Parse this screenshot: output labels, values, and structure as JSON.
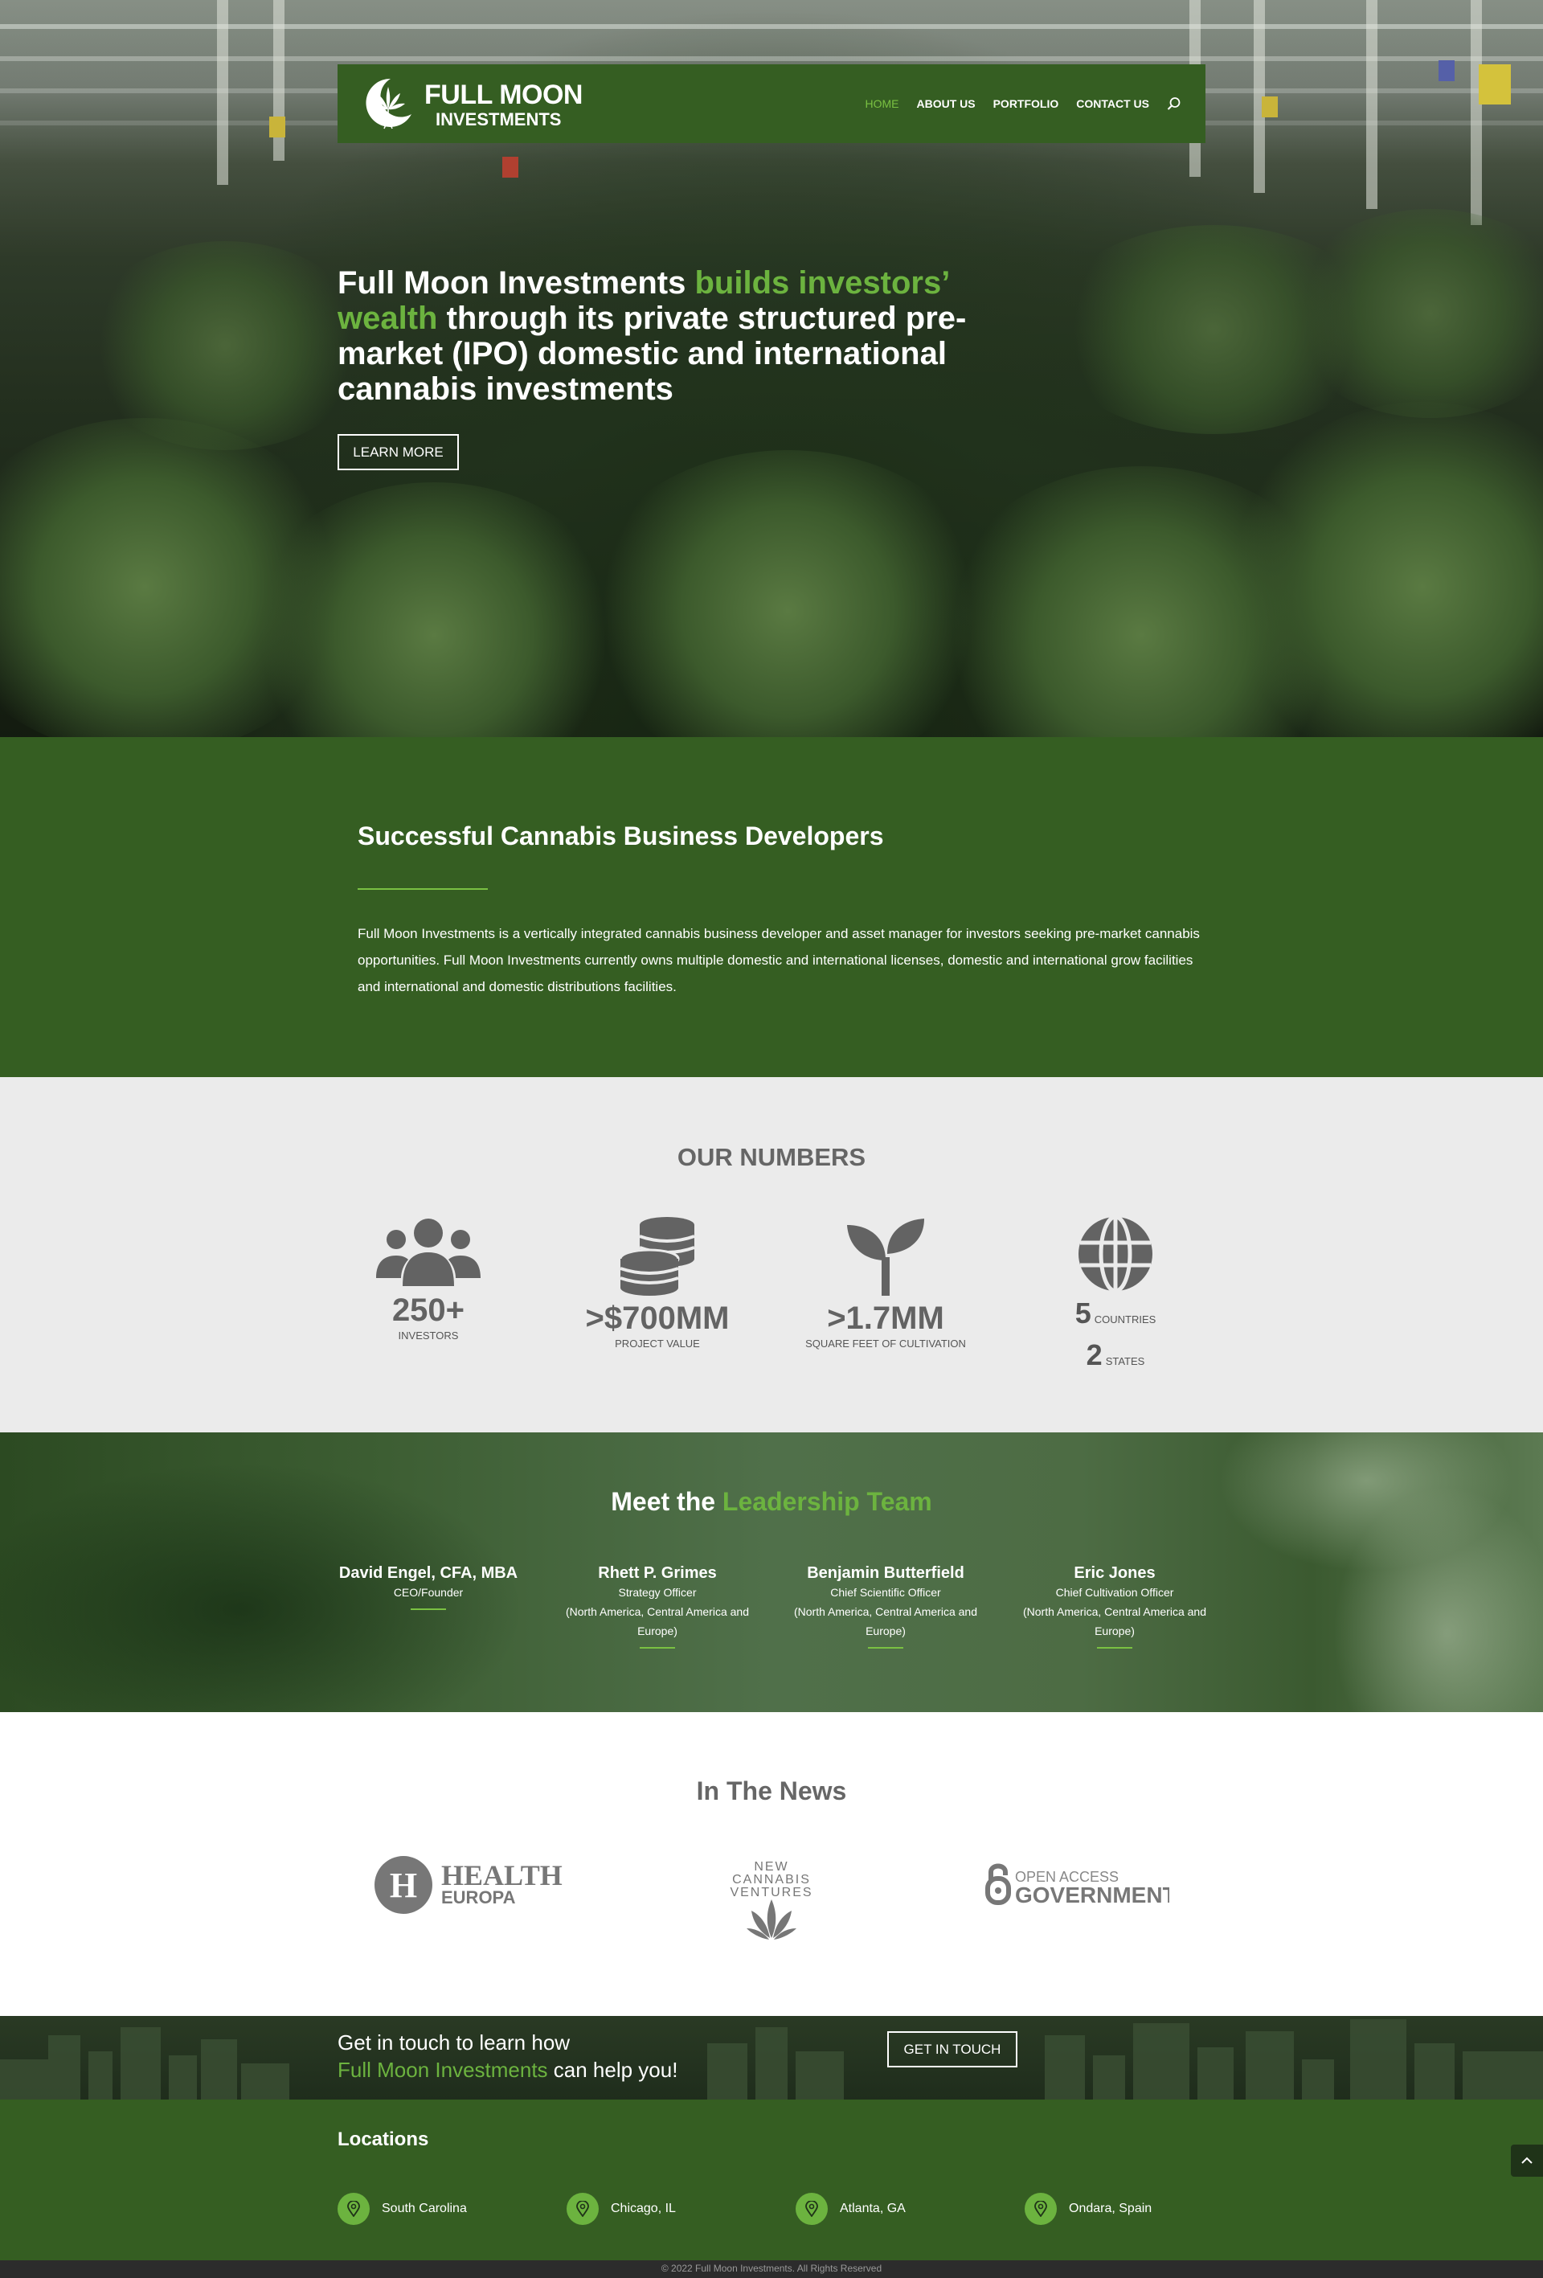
{
  "brand": {
    "name_line1": "FULL MOON",
    "name_line2": "INVESTMENTS"
  },
  "nav": {
    "items": [
      {
        "label": "HOME",
        "active": true
      },
      {
        "label": "ABOUT US",
        "active": false
      },
      {
        "label": "PORTFOLIO",
        "active": false
      },
      {
        "label": "CONTACT US",
        "active": false
      }
    ],
    "search_icon": "search-icon"
  },
  "hero": {
    "headline_part1": "Full Moon Investments ",
    "headline_highlight": "builds investors’ wealth",
    "headline_part2": " through its private structured pre-market (IPO) domestic and international cannabis investments",
    "button_label": "LEARN MORE"
  },
  "about": {
    "title": "Successful Cannabis Business Developers",
    "body": "Full Moon Investments is a vertically integrated cannabis business developer and asset manager for investors seeking pre-market cannabis opportunities. Full Moon Investments currently owns multiple domestic and international licenses, domestic and international grow facilities and international and domestic distributions facilities."
  },
  "numbers": {
    "title": "OUR NUMBERS",
    "stats": [
      {
        "icon": "users-icon",
        "value": "250+",
        "label": "INVESTORS"
      },
      {
        "icon": "coins-icon",
        "value": ">$700MM",
        "label": "PROJECT VALUE"
      },
      {
        "icon": "seedling-icon",
        "value": ">1.7MM",
        "label": "SQUARE FEET OF CULTIVATION"
      }
    ],
    "geo": {
      "icon": "globe-icon",
      "countries_value": "5",
      "countries_label": "COUNTRIES",
      "states_value": "2",
      "states_label": "STATES"
    }
  },
  "team": {
    "title_part1": "Meet the ",
    "title_highlight": "Leadership Team",
    "members": [
      {
        "name": "David Engel, CFA, MBA",
        "role": "CEO/Founder",
        "region": ""
      },
      {
        "name": "Rhett P. Grimes",
        "role": "Strategy Officer",
        "region": "(North America, Central America and Europe)"
      },
      {
        "name": "Benjamin Butterfield",
        "role": "Chief Scientific Officer",
        "region": "(North America, Central America and Europe)"
      },
      {
        "name": "Eric Jones",
        "role": "Chief Cultivation Officer",
        "region": "(North America, Central America and Europe)"
      }
    ]
  },
  "news": {
    "title": "In The News",
    "logos": [
      {
        "name": "health-europa-logo",
        "line1": "HEALTH",
        "line2": "EUROPA"
      },
      {
        "name": "new-cannabis-ventures-logo",
        "line1": "NEW",
        "line2": "CANNABIS",
        "line3": "VENTURES"
      },
      {
        "name": "open-access-government-logo",
        "line1": "OPEN ACCESS",
        "line2": "GOVERNMENT"
      }
    ]
  },
  "cta": {
    "line1": "Get in touch to learn how",
    "line2_highlight": "Full Moon Investments",
    "line2_rest": " can help you!",
    "button_label": "GET IN TOUCH"
  },
  "locations": {
    "title": "Locations",
    "items": [
      {
        "label": "South Carolina"
      },
      {
        "label": "Chicago, IL"
      },
      {
        "label": "Atlanta, GA"
      },
      {
        "label": "Ondara, Spain"
      }
    ]
  },
  "footer": {
    "copyright": "© 2022 Full Moon Investments. All Rights Reserved"
  },
  "colors": {
    "brand_green": "#355e22",
    "accent_green": "#6cb33f",
    "numbers_bg": "#ebebeb",
    "footer_bg": "#2c2c2c"
  }
}
